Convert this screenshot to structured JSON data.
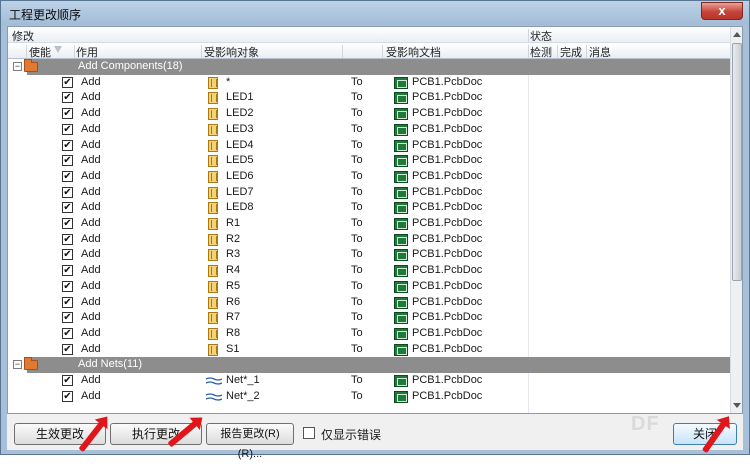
{
  "window": {
    "title": "工程更改顺序",
    "close_glyph": "x"
  },
  "header": {
    "group_modify": "修改",
    "group_status": "状态",
    "col_enable": "使能",
    "col_action": "作用",
    "col_object": "受影响对象",
    "col_document": "受影响文档",
    "col_check": "检测",
    "col_done": "完成",
    "col_message": "消息"
  },
  "groups": [
    {
      "label": "Add Components(18)",
      "expand_glyph": "−",
      "items": [
        {
          "action": "Add",
          "object": "*",
          "to": "To",
          "document": "PCB1.PcbDoc",
          "checked": "✔"
        },
        {
          "action": "Add",
          "object": "LED1",
          "to": "To",
          "document": "PCB1.PcbDoc",
          "checked": "✔"
        },
        {
          "action": "Add",
          "object": "LED2",
          "to": "To",
          "document": "PCB1.PcbDoc",
          "checked": "✔"
        },
        {
          "action": "Add",
          "object": "LED3",
          "to": "To",
          "document": "PCB1.PcbDoc",
          "checked": "✔"
        },
        {
          "action": "Add",
          "object": "LED4",
          "to": "To",
          "document": "PCB1.PcbDoc",
          "checked": "✔"
        },
        {
          "action": "Add",
          "object": "LED5",
          "to": "To",
          "document": "PCB1.PcbDoc",
          "checked": "✔"
        },
        {
          "action": "Add",
          "object": "LED6",
          "to": "To",
          "document": "PCB1.PcbDoc",
          "checked": "✔"
        },
        {
          "action": "Add",
          "object": "LED7",
          "to": "To",
          "document": "PCB1.PcbDoc",
          "checked": "✔"
        },
        {
          "action": "Add",
          "object": "LED8",
          "to": "To",
          "document": "PCB1.PcbDoc",
          "checked": "✔"
        },
        {
          "action": "Add",
          "object": "R1",
          "to": "To",
          "document": "PCB1.PcbDoc",
          "checked": "✔"
        },
        {
          "action": "Add",
          "object": "R2",
          "to": "To",
          "document": "PCB1.PcbDoc",
          "checked": "✔"
        },
        {
          "action": "Add",
          "object": "R3",
          "to": "To",
          "document": "PCB1.PcbDoc",
          "checked": "✔"
        },
        {
          "action": "Add",
          "object": "R4",
          "to": "To",
          "document": "PCB1.PcbDoc",
          "checked": "✔"
        },
        {
          "action": "Add",
          "object": "R5",
          "to": "To",
          "document": "PCB1.PcbDoc",
          "checked": "✔"
        },
        {
          "action": "Add",
          "object": "R6",
          "to": "To",
          "document": "PCB1.PcbDoc",
          "checked": "✔"
        },
        {
          "action": "Add",
          "object": "R7",
          "to": "To",
          "document": "PCB1.PcbDoc",
          "checked": "✔"
        },
        {
          "action": "Add",
          "object": "R8",
          "to": "To",
          "document": "PCB1.PcbDoc",
          "checked": "✔"
        },
        {
          "action": "Add",
          "object": "S1",
          "to": "To",
          "document": "PCB1.PcbDoc",
          "checked": "✔"
        }
      ]
    },
    {
      "label": "Add Nets(11)",
      "expand_glyph": "−",
      "items": [
        {
          "action": "Add",
          "object": "Net*_1",
          "to": "To",
          "document": "PCB1.PcbDoc",
          "checked": "✔"
        },
        {
          "action": "Add",
          "object": "Net*_2",
          "to": "To",
          "document": "PCB1.PcbDoc",
          "checked": "✔"
        }
      ]
    }
  ],
  "buttons": {
    "validate": "生效更改",
    "execute": "执行更改",
    "report": "报告更改(R) (R)...",
    "only_errors": "仅显示错误",
    "close": "关闭"
  },
  "watermark": "DF",
  "colors": {
    "annotation_arrow": "#e0161b",
    "group_row": "#8d8d8d",
    "pcb_icon": "#1f7a3a",
    "component_icon": "#f3d27a"
  }
}
